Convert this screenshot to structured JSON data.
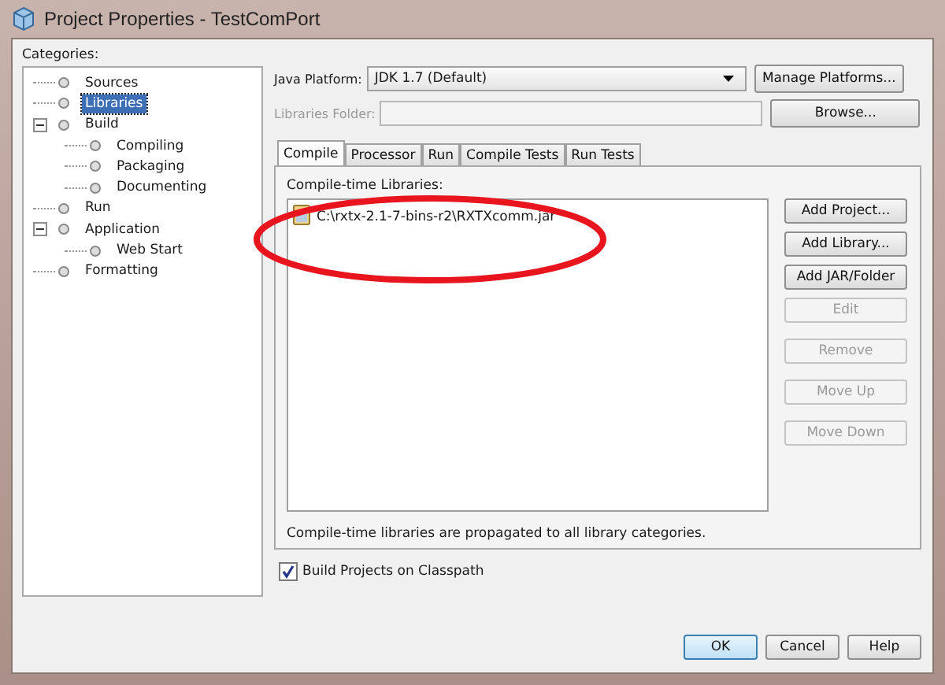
{
  "window": {
    "title": "Project Properties - TestComPort"
  },
  "categories": {
    "label": "Categories:",
    "items": [
      {
        "label": "Sources",
        "selected": false
      },
      {
        "label": "Libraries",
        "selected": true
      },
      {
        "label": "Build",
        "selected": false,
        "expanded": true,
        "children": [
          {
            "label": "Compiling",
            "selected": false
          },
          {
            "label": "Packaging",
            "selected": false
          },
          {
            "label": "Documenting",
            "selected": false
          }
        ]
      },
      {
        "label": "Run",
        "selected": false
      },
      {
        "label": "Application",
        "selected": false,
        "expanded": true,
        "children": [
          {
            "label": "Web Start",
            "selected": false
          }
        ]
      },
      {
        "label": "Formatting",
        "selected": false
      }
    ]
  },
  "java_platform": {
    "label": "Java Platform:",
    "value": "JDK 1.7 (Default)",
    "button": "Manage Platforms..."
  },
  "libraries_folder": {
    "label": "Libraries Folder:",
    "disabled": true,
    "button": "Browse..."
  },
  "tabs": [
    {
      "label": "Compile",
      "selected": true
    },
    {
      "label": "Processor",
      "selected": false
    },
    {
      "label": "Run",
      "selected": false
    },
    {
      "label": "Compile Tests",
      "selected": false
    },
    {
      "label": "Run Tests",
      "selected": false
    }
  ],
  "compile": {
    "label": "Compile-time Libraries:",
    "libraries": [
      "C:\\rxtx-2.1-7-bins-r2\\RXTXcomm.jar"
    ],
    "buttons": [
      {
        "label": "Add Project...",
        "disabled": false
      },
      {
        "label": "Add Library...",
        "disabled": false
      },
      {
        "label": "Add JAR/Folder",
        "disabled": false
      },
      {
        "label": "Edit",
        "disabled": true
      },
      {
        "label": "Remove",
        "disabled": true
      },
      {
        "label": "Move Up",
        "disabled": true
      },
      {
        "label": "Move Down",
        "disabled": true
      }
    ],
    "note": "Compile-time libraries are propagated to all library categories."
  },
  "build_on_classpath": {
    "label": "Build Projects on Classpath",
    "checked": true
  },
  "buttons": [
    {
      "label": "OK",
      "default": true
    },
    {
      "label": "Cancel",
      "default": false
    },
    {
      "label": "Help",
      "default": false
    }
  ]
}
